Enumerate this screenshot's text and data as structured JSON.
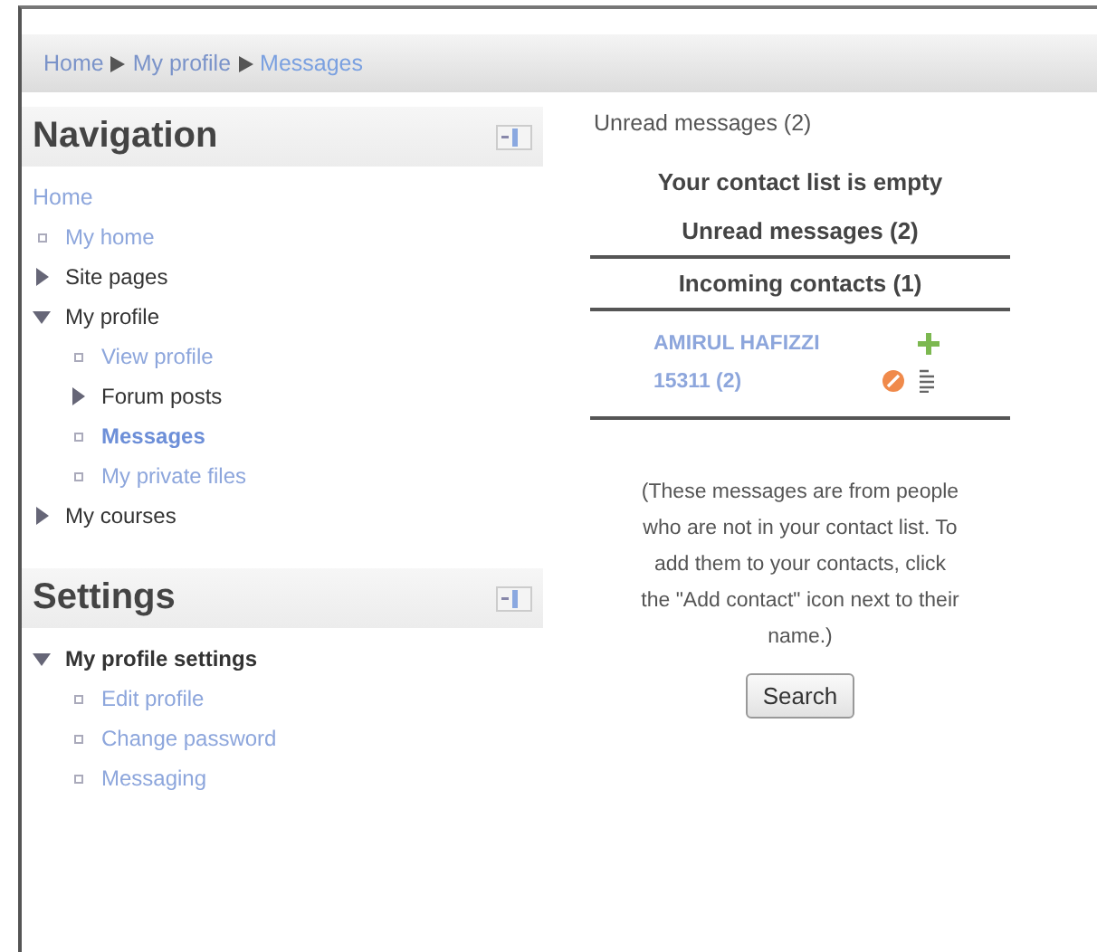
{
  "breadcrumb": [
    {
      "label": "Home",
      "current": false
    },
    {
      "label": "My profile",
      "current": false
    },
    {
      "label": "Messages",
      "current": true
    }
  ],
  "blocks": [
    {
      "title": "Navigation",
      "items": [
        {
          "label": "Home",
          "kind": "root"
        },
        {
          "label": "My home",
          "kind": "leaf",
          "current": false
        },
        {
          "label": "Site pages",
          "kind": "branch",
          "expanded": false
        },
        {
          "label": "My profile",
          "kind": "branch",
          "expanded": true,
          "children": [
            {
              "label": "View profile",
              "kind": "leaf",
              "current": false
            },
            {
              "label": "Forum posts",
              "kind": "branch",
              "expanded": false
            },
            {
              "label": "Messages",
              "kind": "leaf",
              "current": true
            },
            {
              "label": "My private files",
              "kind": "leaf",
              "current": false
            }
          ]
        },
        {
          "label": "My courses",
          "kind": "branch",
          "expanded": false
        }
      ]
    },
    {
      "title": "Settings",
      "items": [
        {
          "label": "My profile settings",
          "kind": "branch",
          "expanded": true,
          "bold": true,
          "children": [
            {
              "label": "Edit profile",
              "kind": "leaf",
              "current": false
            },
            {
              "label": "Change password",
              "kind": "leaf",
              "current": false
            },
            {
              "label": "Messaging",
              "kind": "leaf",
              "current": false
            }
          ]
        }
      ]
    }
  ],
  "messages": {
    "tab": "Unread messages (2)",
    "empty_note": "Your contact list is empty",
    "sections": [
      "Unread messages (2)",
      "Incoming contacts (1)"
    ],
    "contacts": [
      {
        "name": "AMIRUL HAFIZZI 15311 (2)"
      }
    ],
    "note": "(These messages are from people who are not in your contact list. To add them to your contacts, click the \"Add contact\" icon next to their name.)",
    "button": "Search"
  }
}
